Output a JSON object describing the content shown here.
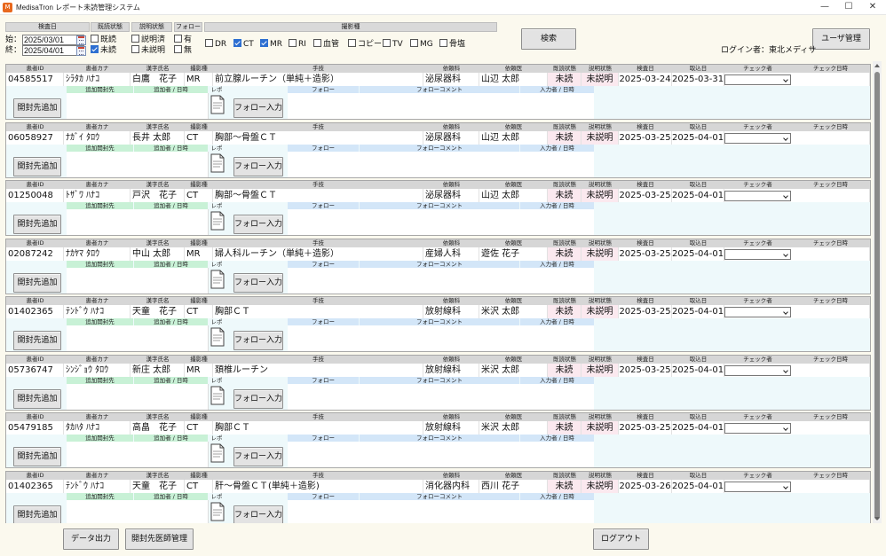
{
  "window": {
    "title": "MedisaTron レポート未読管理システム",
    "app_icon": "app-logo-icon",
    "controls": [
      "minimize-icon",
      "maximize-icon",
      "close-icon"
    ]
  },
  "filters": {
    "exam_date_header": "検査日",
    "read_status_header": "既読状態",
    "explain_status_header": "説明状態",
    "follow_header": "フォロー",
    "modality_header": "撮影種",
    "start_label": "始：",
    "start_date": "2025/03/01",
    "end_label": "終：",
    "end_date": "2025/04/01",
    "read_options": [
      {
        "label": "既読",
        "checked": false
      },
      {
        "label": "未読",
        "checked": true
      }
    ],
    "explain_options": [
      {
        "label": "説明済",
        "checked": false
      },
      {
        "label": "未説明",
        "checked": false
      }
    ],
    "follow_options": [
      {
        "label": "有",
        "checked": false
      },
      {
        "label": "無",
        "checked": false
      }
    ],
    "modalities": [
      {
        "label": "DR",
        "checked": false
      },
      {
        "label": "CT",
        "checked": true
      },
      {
        "label": "MR",
        "checked": true
      },
      {
        "label": "RI",
        "checked": false
      },
      {
        "label": "血管",
        "checked": false
      },
      {
        "label": "コピー",
        "checked": false
      },
      {
        "label": "TV",
        "checked": false
      },
      {
        "label": "MG",
        "checked": false
      },
      {
        "label": "骨塩",
        "checked": false
      }
    ]
  },
  "search_button": "検索",
  "user_mgmt_button": "ユーザ管理",
  "login_label": "ログイン者：東北メディサ",
  "record_headers": [
    "患者ID",
    "患者カナ",
    "漢字氏名",
    "撮影種",
    "手技",
    "依頼科",
    "依頼医",
    "既読状態",
    "説明状態",
    "検査日",
    "取込日",
    "チェック者",
    "チェック日時"
  ],
  "follow_headers": {
    "open_add": "開封先追加",
    "add_target": "追加開封先",
    "added_by": "追加者 / 日時",
    "report": "レポ",
    "follow_input": "フォロー入力",
    "follow": "フォロー",
    "follow_comment": "フォローコメント",
    "input_by": "入力者 / 日時"
  },
  "records": [
    {
      "id": "04585517",
      "kana": "ｼﾗﾀｶ ﾊﾅｺ",
      "name": "白鷹　花子",
      "modality": "MR",
      "procedure": "前立腺ルーチン（単純＋造影）",
      "dept": "泌尿器科",
      "doctor": "山辺 太郎",
      "read": "未読",
      "explain": "未説明",
      "exam_date": "2025-03-24",
      "import_date": "2025-03-31",
      "checker": "",
      "check_time": ""
    },
    {
      "id": "06058927",
      "kana": "ﾅｶﾞｲ ﾀﾛｳ",
      "name": "長井 太郎",
      "modality": "CT",
      "procedure": "胸部～骨盤ＣＴ",
      "dept": "泌尿器科",
      "doctor": "山辺 太郎",
      "read": "未読",
      "explain": "未説明",
      "exam_date": "2025-03-25",
      "import_date": "2025-04-01",
      "checker": "",
      "check_time": ""
    },
    {
      "id": "01250048",
      "kana": "ﾄｻﾞﾜ ﾊﾅｺ",
      "name": "戸沢　花子",
      "modality": "CT",
      "procedure": "胸部～骨盤ＣＴ",
      "dept": "泌尿器科",
      "doctor": "山辺 太郎",
      "read": "未読",
      "explain": "未説明",
      "exam_date": "2025-03-25",
      "import_date": "2025-04-01",
      "checker": "",
      "check_time": ""
    },
    {
      "id": "02087242",
      "kana": "ﾅｶﾔﾏ ﾀﾛｳ",
      "name": "中山 太郎",
      "modality": "MR",
      "procedure": "婦人科ルーチン（単純＋造影）",
      "dept": "産婦人科",
      "doctor": "遊佐 花子",
      "read": "未読",
      "explain": "未説明",
      "exam_date": "2025-03-25",
      "import_date": "2025-04-01",
      "checker": "",
      "check_time": ""
    },
    {
      "id": "01402365",
      "kana": "ﾃﾝﾄﾞｳ ﾊﾅｺ",
      "name": "天童　花子",
      "modality": "CT",
      "procedure": "胸部ＣＴ",
      "dept": "放射線科",
      "doctor": "米沢 太郎",
      "read": "未読",
      "explain": "未説明",
      "exam_date": "2025-03-25",
      "import_date": "2025-04-01",
      "checker": "",
      "check_time": ""
    },
    {
      "id": "05736747",
      "kana": "ｼﾝｼﾞｮｳ ﾀﾛｳ",
      "name": "新庄 太郎",
      "modality": "MR",
      "procedure": "頚椎ルーチン",
      "dept": "放射線科",
      "doctor": "米沢 太郎",
      "read": "未読",
      "explain": "未説明",
      "exam_date": "2025-03-25",
      "import_date": "2025-04-01",
      "checker": "",
      "check_time": ""
    },
    {
      "id": "05479185",
      "kana": "ﾀｶﾊﾀ ﾊﾅｺ",
      "name": "高畠　花子",
      "modality": "CT",
      "procedure": "胸部ＣＴ",
      "dept": "放射線科",
      "doctor": "米沢 太郎",
      "read": "未読",
      "explain": "未説明",
      "exam_date": "2025-03-25",
      "import_date": "2025-04-01",
      "checker": "",
      "check_time": ""
    },
    {
      "id": "01402365",
      "kana": "ﾃﾝﾄﾞｳ ﾊﾅｺ",
      "name": "天童　花子",
      "modality": "CT",
      "procedure": "肝～骨盤ＣＴ(単純＋造影)",
      "dept": "消化器内科",
      "doctor": "西川 花子",
      "read": "未読",
      "explain": "未説明",
      "exam_date": "2025-03-26",
      "import_date": "2025-04-01",
      "checker": "",
      "check_time": ""
    }
  ],
  "footer": {
    "data_output": "データ出力",
    "doctor_mgmt": "開封先医師管理",
    "logout": "ログアウト"
  }
}
